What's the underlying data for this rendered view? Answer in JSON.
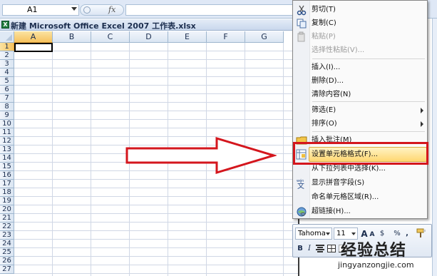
{
  "formula_bar": {
    "name_box": "A1",
    "fx": "fx",
    "formula": ""
  },
  "workbook": {
    "title": "新建 Microsoft Office Excel 2007 工作表.xlsx",
    "icon_glyph": "X"
  },
  "sheet": {
    "columns": [
      "A",
      "B",
      "C",
      "D",
      "E",
      "F",
      "G"
    ],
    "rows": [
      "1",
      "2",
      "3",
      "4",
      "5",
      "6",
      "7",
      "8",
      "9",
      "10",
      "11",
      "12",
      "13",
      "14",
      "15",
      "16",
      "17",
      "18",
      "19",
      "20",
      "21",
      "22",
      "23",
      "24",
      "25",
      "26",
      "27"
    ],
    "selected_column": "A",
    "selected_row": "1"
  },
  "context_menu": {
    "items": [
      {
        "label": "剪切(T)",
        "icon": "scissors-icon",
        "enabled": true
      },
      {
        "label": "复制(C)",
        "icon": "copy-icon",
        "enabled": true
      },
      {
        "label": "粘贴(P)",
        "icon": "paste-icon",
        "enabled": false
      },
      {
        "label": "选择性粘贴(V)...",
        "icon": "",
        "enabled": false
      },
      {
        "label": "插入(I)...",
        "icon": "",
        "enabled": true
      },
      {
        "label": "删除(D)...",
        "icon": "",
        "enabled": true
      },
      {
        "label": "清除内容(N)",
        "icon": "",
        "enabled": true
      },
      {
        "label": "筛选(E)",
        "icon": "",
        "enabled": true,
        "submenu": true
      },
      {
        "label": "排序(O)",
        "icon": "",
        "enabled": true,
        "submenu": true
      },
      {
        "label": "插入批注(M)",
        "icon": "comment-icon",
        "enabled": true
      },
      {
        "label": "设置单元格格式(F)...",
        "icon": "format-cells-icon",
        "enabled": true,
        "highlighted": true
      },
      {
        "label": "从下拉列表中选择(K)...",
        "icon": "",
        "enabled": true
      },
      {
        "label": "显示拼音字段(S)",
        "icon": "phonetic-icon",
        "enabled": true
      },
      {
        "label": "命名单元格区域(R)...",
        "icon": "",
        "enabled": true
      },
      {
        "label": "超链接(H)...",
        "icon": "hyperlink-icon",
        "enabled": true
      }
    ]
  },
  "mini_toolbar": {
    "font": "Tahoma",
    "size": "11",
    "grow_font": "A",
    "shrink_font": "A",
    "currency": "$",
    "percent": "%",
    "comma": ",",
    "bold": "B",
    "italic": "I"
  },
  "watermark": {
    "brand": "经验总结",
    "url": "jingyanzongjie.com"
  },
  "colors": {
    "arrow_outline": "#d4161d",
    "highlight_box": "#d4161d",
    "selection_header": "#f6c25e"
  }
}
